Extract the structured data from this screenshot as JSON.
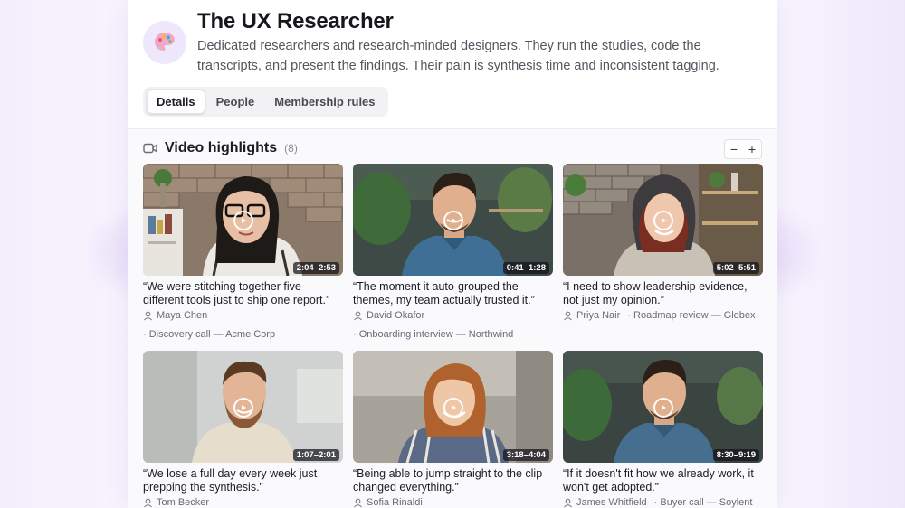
{
  "persona": {
    "title": "The UX Researcher",
    "description": "Dedicated researchers and research-minded designers. They run the studies, code the transcripts, and present the findings. Their pain is synthesis time and inconsistent tagging.",
    "avatar_icon": "palette-icon"
  },
  "tabs": [
    {
      "label": "Details",
      "active": true
    },
    {
      "label": "People",
      "active": false
    },
    {
      "label": "Membership rules",
      "active": false
    }
  ],
  "highlights": {
    "title": "Video highlights",
    "count": "(8)",
    "zoom_out": "−",
    "zoom_in": "+",
    "items": [
      {
        "time": "2:04–2:53",
        "quote": "“We were stitching together five different tools just to ship one report.”",
        "person": "Maya Chen",
        "session": "· Discovery call — Acme Corp"
      },
      {
        "time": "0:41–1:28",
        "quote": "“The moment it auto-grouped the themes, my team actually trusted it.”",
        "person": "David Okafor",
        "session": "· Onboarding interview — Northwind"
      },
      {
        "time": "5:02–5:51",
        "quote": "“I need to show leadership evidence, not just my opinion.”",
        "person": "Priya Nair",
        "session": "· Roadmap review — Globex"
      },
      {
        "time": "1:07–2:01",
        "quote": "“We lose a full day every week just prepping the synthesis.”",
        "person": "Tom Becker",
        "session": ""
      },
      {
        "time": "3:18–4:04",
        "quote": "“Being able to jump straight to the clip changed everything.”",
        "person": "Sofia Rinaldi",
        "session": ""
      },
      {
        "time": "8:30–9:19",
        "quote": "“If it doesn't fit how we already work, it won't get adopted.”",
        "person": "James Whitfield",
        "session": "· Buyer call — Soylent"
      }
    ]
  }
}
